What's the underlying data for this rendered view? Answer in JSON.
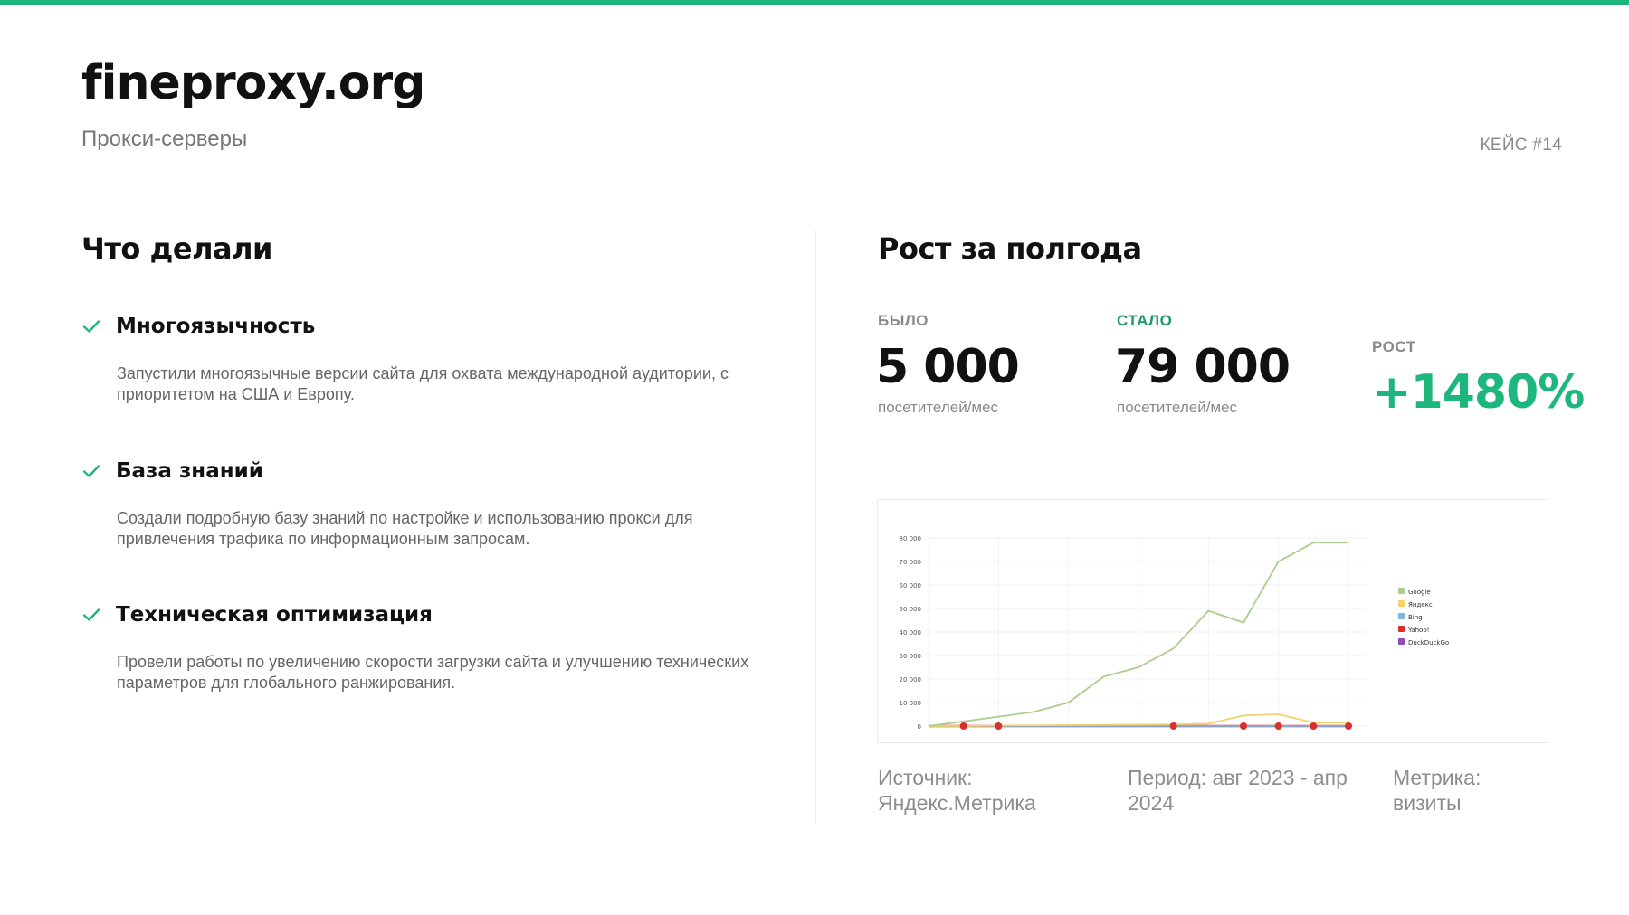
{
  "brand": "fineproxy.org",
  "subtitle": "Прокси-серверы",
  "case_number": "КЕЙС #14",
  "left": {
    "title": "Что делали",
    "items": [
      {
        "title": "Многоязычность",
        "description": "Запустили многоязычные версии сайта для охвата международной аудитории, с приоритетом на США и Европу."
      },
      {
        "title": "База знаний",
        "description": "Создали подробную базу знаний по настройке и использованию прокси для привлечения трафика по информационным запросам."
      },
      {
        "title": "Техническая оптимизация",
        "description": "Провели работы по увеличению скорости загрузки сайта и улучшению технических параметров для глобального ранжирования."
      }
    ]
  },
  "right": {
    "title": "Рост за полгода",
    "before": {
      "label": "БЫЛО",
      "value": "5 000",
      "unit": "посетителей/мес"
    },
    "after": {
      "label": "СТАЛО",
      "value": "79 000",
      "unit": "посетителей/мес"
    },
    "growth": {
      "label": "РОСТ",
      "value": "+1480%"
    }
  },
  "colors": {
    "accent": "#1db77e",
    "accent_dark": "#1c9a69",
    "google": "#a9cf8c",
    "yandex": "#f2d36b",
    "bing": "#7fb6e0",
    "yahoo": "#d9302b",
    "duckduckgo": "#8e4fb5"
  },
  "chart_data": {
    "type": "line",
    "ylim": [
      0,
      80000
    ],
    "y_ticks": [
      "80 000",
      "70 000",
      "60 000",
      "50 000",
      "40 000",
      "30 000",
      "20 000",
      "10 000",
      "0"
    ],
    "x": [
      0,
      1,
      2,
      3,
      4,
      5,
      6,
      7,
      8,
      9,
      10,
      11,
      12
    ],
    "series": [
      {
        "name": "Google",
        "color": "#a9cf8c",
        "values": [
          0,
          2000,
          4000,
          6000,
          10000,
          21000,
          25000,
          33000,
          49000,
          44000,
          70000,
          78000,
          78000
        ]
      },
      {
        "name": "Яндекс",
        "color": "#f2d36b",
        "values": [
          0,
          0,
          200,
          300,
          400,
          500,
          600,
          700,
          1000,
          4500,
          5000,
          1500,
          1500
        ]
      },
      {
        "name": "Bing",
        "color": "#7fb6e0",
        "values": [
          0,
          0,
          0,
          0,
          0,
          0,
          0,
          0,
          0,
          0,
          0,
          0,
          0
        ]
      },
      {
        "name": "Yahoo!",
        "color": "#d9302b",
        "values": [
          0,
          0,
          0,
          0,
          0,
          0,
          0,
          0,
          0,
          0,
          0,
          0,
          0
        ]
      },
      {
        "name": "DuckDuckGo",
        "color": "#8e4fb5",
        "values": [
          0,
          0,
          0,
          0,
          0,
          0,
          0,
          0,
          0,
          0,
          0,
          0,
          0
        ]
      }
    ],
    "legend": "right"
  },
  "footer": {
    "source": "Источник: Яндекс.Метрика",
    "period": "Период: авг 2023 - апр 2024",
    "metric": "Метрика: визиты"
  }
}
